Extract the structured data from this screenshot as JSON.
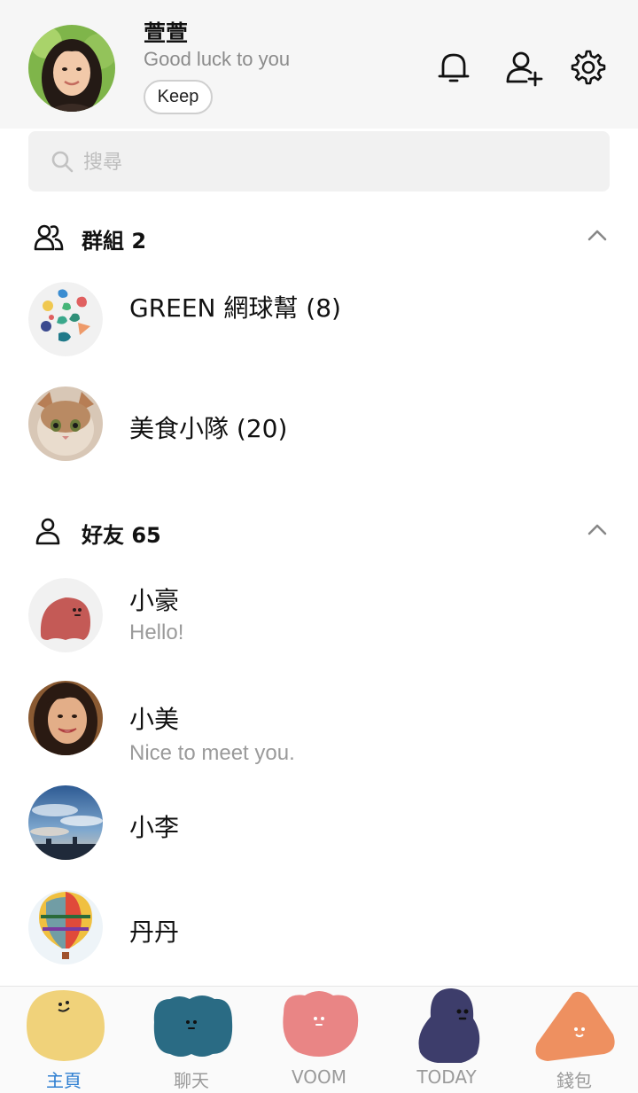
{
  "profile": {
    "name": "萱萱",
    "status": "Good luck to you",
    "keep_label": "Keep"
  },
  "header_icons": [
    "bell-icon",
    "add-friend-icon",
    "settings-icon"
  ],
  "search": {
    "placeholder": "搜尋"
  },
  "groups": {
    "title": "群組 2",
    "items": [
      {
        "name": "GREEN 網球幫 (8)"
      },
      {
        "name": "美食小隊 (20)"
      }
    ]
  },
  "friends": {
    "title": "好友 65",
    "items": [
      {
        "name": "小豪",
        "message": "Hello!"
      },
      {
        "name": "小美",
        "message": "Nice to meet you."
      },
      {
        "name": "小李",
        "message": ""
      },
      {
        "name": "丹丹",
        "message": ""
      }
    ]
  },
  "bottom_nav": {
    "items": [
      {
        "label": "主頁",
        "active": true,
        "color": "#f0d27a"
      },
      {
        "label": "聊天",
        "active": false,
        "color": "#2a6b84"
      },
      {
        "label": "VOOM",
        "active": false,
        "color": "#e98585"
      },
      {
        "label": "TODAY",
        "active": false,
        "color": "#3d3d6b"
      },
      {
        "label": "錢包",
        "active": false,
        "color": "#ee9060"
      }
    ]
  },
  "colors": {
    "active_nav": "#2f7fd1",
    "header_bg": "#f6f6f6",
    "muted_text": "#9a9a9a"
  }
}
